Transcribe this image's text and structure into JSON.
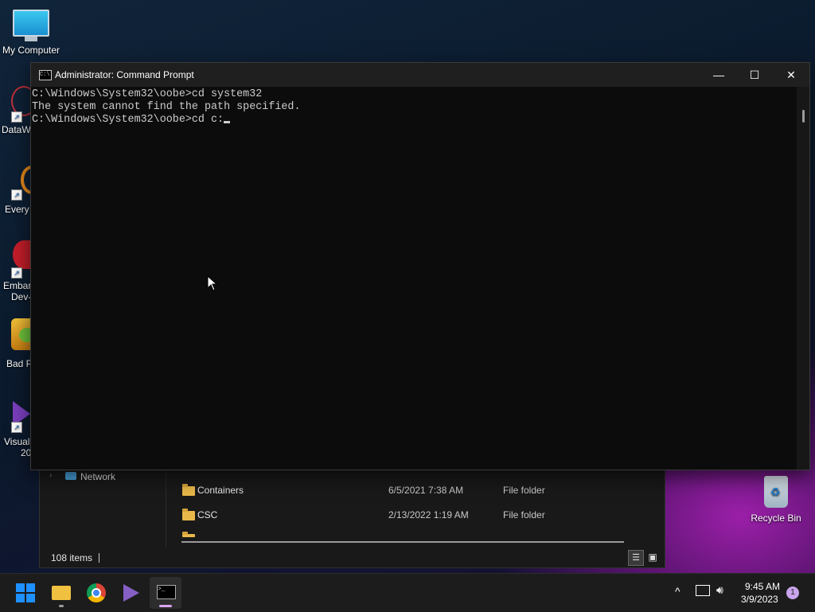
{
  "desktop": {
    "icons": [
      {
        "label": "My Computer"
      },
      {
        "label": "DataW"
      },
      {
        "label": "Every"
      },
      {
        "label": "Embar"
      },
      {
        "label": "Dev-"
      },
      {
        "label": "Bad P"
      },
      {
        "label": "Visual"
      },
      {
        "label": "20"
      },
      {
        "label": "Recycle Bin"
      }
    ]
  },
  "cmd": {
    "title": "Administrator: Command Prompt",
    "lines": [
      "C:\\Windows\\System32\\oobe>cd system32",
      "The system cannot find the path specified.",
      "",
      "C:\\Windows\\System32\\oobe>cd c:"
    ],
    "controls": {
      "minimize": "—",
      "maximize": "☐",
      "close": "✕"
    }
  },
  "explorer": {
    "nav_network": "Network",
    "rows": [
      {
        "name": "Containers",
        "date": "6/5/2021 7:38 AM",
        "type": "File folder"
      },
      {
        "name": "CSC",
        "date": "2/13/2022 1:19 AM",
        "type": "File folder"
      }
    ],
    "status": "108 items"
  },
  "taskbar": {
    "apps": [
      "start-icon",
      "file-explorer-icon",
      "chrome-icon",
      "visual-studio-icon",
      "terminal-icon"
    ],
    "clock_time": "9:45 AM",
    "clock_date": "3/9/2023",
    "notification_count": "1",
    "accent": "#0078d4"
  }
}
